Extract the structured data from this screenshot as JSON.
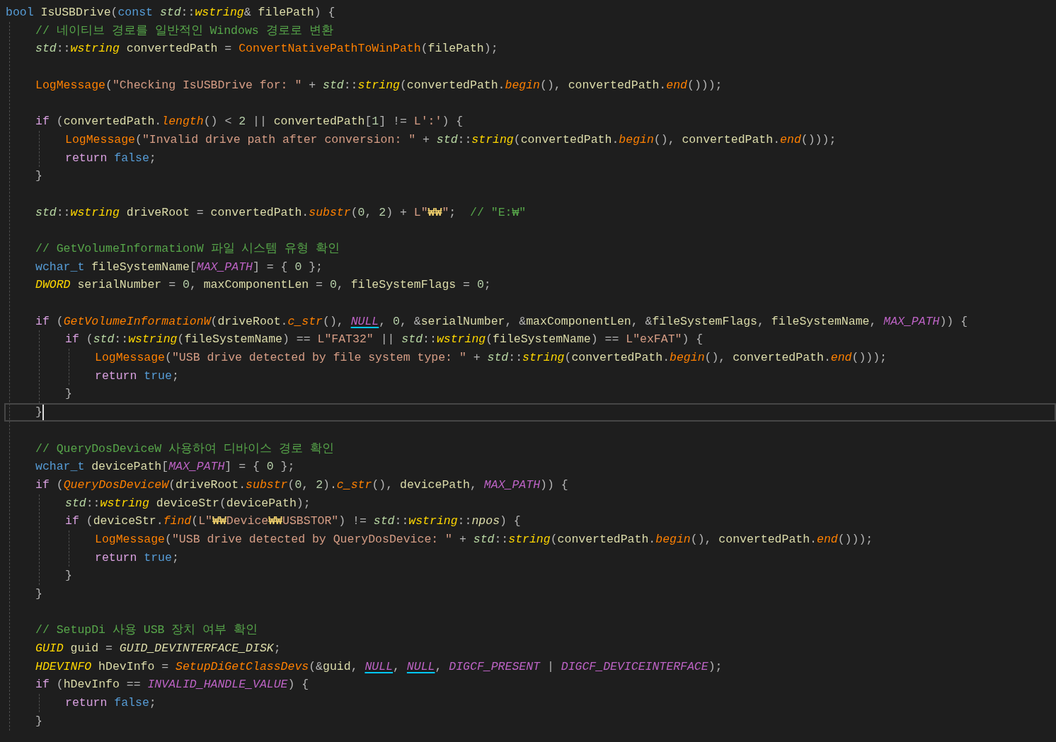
{
  "editor": {
    "lines": [
      {
        "current": false,
        "tokens": [
          {
            "kind": "kw",
            "text": "bool "
          },
          {
            "kind": "var",
            "text": "IsUSBDrive"
          },
          {
            "kind": "p",
            "text": "("
          },
          {
            "kind": "kw",
            "text": "const "
          },
          {
            "kind": "ns",
            "text": "std"
          },
          {
            "kind": "p",
            "text": "::"
          },
          {
            "kind": "type",
            "text": "wstring"
          },
          {
            "kind": "p",
            "text": "& "
          },
          {
            "kind": "var",
            "text": "filePath"
          },
          {
            "kind": "p",
            "text": ") {"
          }
        ],
        "children": [
          {
            "current": false,
            "tokens": [
              {
                "kind": "cmt",
                "text": "// 네이티브 경로를 일반적인 Windows 경로로 변환"
              }
            ]
          },
          {
            "current": false,
            "tokens": [
              {
                "kind": "ns",
                "text": "std"
              },
              {
                "kind": "p",
                "text": "::"
              },
              {
                "kind": "type",
                "text": "wstring"
              },
              {
                "kind": "var",
                "text": " convertedPath"
              },
              {
                "kind": "p",
                "text": " = "
              },
              {
                "kind": "fn",
                "text": "ConvertNativePathToWinPath"
              },
              {
                "kind": "p",
                "text": "("
              },
              {
                "kind": "var",
                "text": "filePath"
              },
              {
                "kind": "p",
                "text": ");"
              }
            ]
          },
          {
            "current": false
          },
          {
            "current": false,
            "tokens": [
              {
                "kind": "fn",
                "text": "LogMessage"
              },
              {
                "kind": "p",
                "text": "("
              },
              {
                "kind": "str",
                "text": "\"Checking IsUSBDrive for: \""
              },
              {
                "kind": "p",
                "text": " + "
              },
              {
                "kind": "ns",
                "text": "std"
              },
              {
                "kind": "p",
                "text": "::"
              },
              {
                "kind": "type",
                "text": "string"
              },
              {
                "kind": "p",
                "text": "("
              },
              {
                "kind": "var",
                "text": "convertedPath"
              },
              {
                "kind": "p",
                "text": "."
              },
              {
                "kind": "method",
                "text": "begin"
              },
              {
                "kind": "p",
                "text": "(), "
              },
              {
                "kind": "var",
                "text": "convertedPath"
              },
              {
                "kind": "p",
                "text": "."
              },
              {
                "kind": "method",
                "text": "end"
              },
              {
                "kind": "p",
                "text": "()));"
              }
            ]
          },
          {
            "current": false
          },
          {
            "current": false,
            "tokens": [
              {
                "kind": "ctrl",
                "text": "if"
              },
              {
                "kind": "p",
                "text": " ("
              },
              {
                "kind": "var",
                "text": "convertedPath"
              },
              {
                "kind": "p",
                "text": "."
              },
              {
                "kind": "method",
                "text": "length"
              },
              {
                "kind": "p",
                "text": "() < "
              },
              {
                "kind": "num",
                "text": "2"
              },
              {
                "kind": "p",
                "text": " || "
              },
              {
                "kind": "var",
                "text": "convertedPath"
              },
              {
                "kind": "p",
                "text": "["
              },
              {
                "kind": "num",
                "text": "1"
              },
              {
                "kind": "p",
                "text": "] != "
              },
              {
                "kind": "str",
                "text": "L':'"
              },
              {
                "kind": "p",
                "text": ") {"
              }
            ],
            "children": [
              {
                "current": false,
                "tokens": [
                  {
                    "kind": "fn",
                    "text": "LogMessage"
                  },
                  {
                    "kind": "p",
                    "text": "("
                  },
                  {
                    "kind": "str",
                    "text": "\"Invalid drive path after conversion: \""
                  },
                  {
                    "kind": "p",
                    "text": " + "
                  },
                  {
                    "kind": "ns",
                    "text": "std"
                  },
                  {
                    "kind": "p",
                    "text": "::"
                  },
                  {
                    "kind": "type",
                    "text": "string"
                  },
                  {
                    "kind": "p",
                    "text": "("
                  },
                  {
                    "kind": "var",
                    "text": "convertedPath"
                  },
                  {
                    "kind": "p",
                    "text": "."
                  },
                  {
                    "kind": "method",
                    "text": "begin"
                  },
                  {
                    "kind": "p",
                    "text": "(), "
                  },
                  {
                    "kind": "var",
                    "text": "convertedPath"
                  },
                  {
                    "kind": "p",
                    "text": "."
                  },
                  {
                    "kind": "method",
                    "text": "end"
                  },
                  {
                    "kind": "p",
                    "text": "()));"
                  }
                ]
              },
              {
                "current": false,
                "tokens": [
                  {
                    "kind": "ctrl",
                    "text": "return "
                  },
                  {
                    "kind": "kw",
                    "text": "false"
                  },
                  {
                    "kind": "p",
                    "text": ";"
                  }
                ]
              }
            ]
          },
          {
            "current": false,
            "tokens": [
              {
                "kind": "p",
                "text": "}"
              }
            ]
          },
          {
            "current": false
          },
          {
            "current": false,
            "tokens": [
              {
                "kind": "ns",
                "text": "std"
              },
              {
                "kind": "p",
                "text": "::"
              },
              {
                "kind": "type",
                "text": "wstring"
              },
              {
                "kind": "var",
                "text": " driveRoot"
              },
              {
                "kind": "p",
                "text": " = "
              },
              {
                "kind": "var",
                "text": "convertedPath"
              },
              {
                "kind": "p",
                "text": "."
              },
              {
                "kind": "method",
                "text": "substr"
              },
              {
                "kind": "p",
                "text": "("
              },
              {
                "kind": "num",
                "text": "0"
              },
              {
                "kind": "p",
                "text": ", "
              },
              {
                "kind": "num",
                "text": "2"
              },
              {
                "kind": "p",
                "text": ") + "
              },
              {
                "kind": "str",
                "text": "L\""
              },
              {
                "kind": "esc",
                "text": "₩₩"
              },
              {
                "kind": "str",
                "text": "\""
              },
              {
                "kind": "p",
                "text": ";  "
              },
              {
                "kind": "cmt",
                "text": "// \"E:₩\""
              }
            ]
          },
          {
            "current": false
          },
          {
            "current": false,
            "tokens": [
              {
                "kind": "cmt",
                "text": "// GetVolumeInformationW 파일 시스템 유형 확인"
              }
            ]
          },
          {
            "current": false,
            "tokens": [
              {
                "kind": "kw",
                "text": "wchar_t"
              },
              {
                "kind": "var",
                "text": " fileSystemName"
              },
              {
                "kind": "p",
                "text": "["
              },
              {
                "kind": "macro",
                "text": "MAX_PATH"
              },
              {
                "kind": "p",
                "text": "] = { "
              },
              {
                "kind": "num",
                "text": "0"
              },
              {
                "kind": "p",
                "text": " };"
              }
            ]
          },
          {
            "current": false,
            "tokens": [
              {
                "kind": "type",
                "text": "DWORD"
              },
              {
                "kind": "var",
                "text": " serialNumber"
              },
              {
                "kind": "p",
                "text": " = "
              },
              {
                "kind": "num",
                "text": "0"
              },
              {
                "kind": "p",
                "text": ", "
              },
              {
                "kind": "var",
                "text": "maxComponentLen"
              },
              {
                "kind": "p",
                "text": " = "
              },
              {
                "kind": "num",
                "text": "0"
              },
              {
                "kind": "p",
                "text": ", "
              },
              {
                "kind": "var",
                "text": "fileSystemFlags"
              },
              {
                "kind": "p",
                "text": " = "
              },
              {
                "kind": "num",
                "text": "0"
              },
              {
                "kind": "p",
                "text": ";"
              }
            ]
          },
          {
            "current": false
          },
          {
            "current": false,
            "tokens": [
              {
                "kind": "ctrl",
                "text": "if"
              },
              {
                "kind": "p",
                "text": " ("
              },
              {
                "kind": "method",
                "text": "GetVolumeInformationW"
              },
              {
                "kind": "p",
                "text": "("
              },
              {
                "kind": "var",
                "text": "driveRoot"
              },
              {
                "kind": "p",
                "text": "."
              },
              {
                "kind": "method",
                "text": "c_str"
              },
              {
                "kind": "p",
                "text": "(), "
              },
              {
                "kind": "null",
                "text": "NULL"
              },
              {
                "kind": "p",
                "text": ", "
              },
              {
                "kind": "num",
                "text": "0"
              },
              {
                "kind": "p",
                "text": ", &"
              },
              {
                "kind": "var",
                "text": "serialNumber"
              },
              {
                "kind": "p",
                "text": ", &"
              },
              {
                "kind": "var",
                "text": "maxComponentLen"
              },
              {
                "kind": "p",
                "text": ", &"
              },
              {
                "kind": "var",
                "text": "fileSystemFlags"
              },
              {
                "kind": "p",
                "text": ", "
              },
              {
                "kind": "var",
                "text": "fileSystemName"
              },
              {
                "kind": "p",
                "text": ", "
              },
              {
                "kind": "macro",
                "text": "MAX_PATH"
              },
              {
                "kind": "p",
                "text": ")) {"
              }
            ],
            "children": [
              {
                "current": false,
                "tokens": [
                  {
                    "kind": "ctrl",
                    "text": "if"
                  },
                  {
                    "kind": "p",
                    "text": " ("
                  },
                  {
                    "kind": "ns",
                    "text": "std"
                  },
                  {
                    "kind": "p",
                    "text": "::"
                  },
                  {
                    "kind": "type",
                    "text": "wstring"
                  },
                  {
                    "kind": "p",
                    "text": "("
                  },
                  {
                    "kind": "var",
                    "text": "fileSystemName"
                  },
                  {
                    "kind": "p",
                    "text": ") == "
                  },
                  {
                    "kind": "str",
                    "text": "L\"FAT32\""
                  },
                  {
                    "kind": "p",
                    "text": " || "
                  },
                  {
                    "kind": "ns",
                    "text": "std"
                  },
                  {
                    "kind": "p",
                    "text": "::"
                  },
                  {
                    "kind": "type",
                    "text": "wstring"
                  },
                  {
                    "kind": "p",
                    "text": "("
                  },
                  {
                    "kind": "var",
                    "text": "fileSystemName"
                  },
                  {
                    "kind": "p",
                    "text": ") == "
                  },
                  {
                    "kind": "str",
                    "text": "L\"exFAT\""
                  },
                  {
                    "kind": "p",
                    "text": ") {"
                  }
                ],
                "children": [
                  {
                    "current": false,
                    "tokens": [
                      {
                        "kind": "fn",
                        "text": "LogMessage"
                      },
                      {
                        "kind": "p",
                        "text": "("
                      },
                      {
                        "kind": "str",
                        "text": "\"USB drive detected by file system type: \""
                      },
                      {
                        "kind": "p",
                        "text": " + "
                      },
                      {
                        "kind": "ns",
                        "text": "std"
                      },
                      {
                        "kind": "p",
                        "text": "::"
                      },
                      {
                        "kind": "type",
                        "text": "string"
                      },
                      {
                        "kind": "p",
                        "text": "("
                      },
                      {
                        "kind": "var",
                        "text": "convertedPath"
                      },
                      {
                        "kind": "p",
                        "text": "."
                      },
                      {
                        "kind": "method",
                        "text": "begin"
                      },
                      {
                        "kind": "p",
                        "text": "(), "
                      },
                      {
                        "kind": "var",
                        "text": "convertedPath"
                      },
                      {
                        "kind": "p",
                        "text": "."
                      },
                      {
                        "kind": "method",
                        "text": "end"
                      },
                      {
                        "kind": "p",
                        "text": "()));"
                      }
                    ]
                  },
                  {
                    "current": false,
                    "tokens": [
                      {
                        "kind": "ctrl",
                        "text": "return "
                      },
                      {
                        "kind": "kw",
                        "text": "true"
                      },
                      {
                        "kind": "p",
                        "text": ";"
                      }
                    ]
                  }
                ]
              },
              {
                "current": false,
                "tokens": [
                  {
                    "kind": "p",
                    "text": "}"
                  }
                ]
              }
            ]
          },
          {
            "current": true,
            "tokens": [
              {
                "kind": "p",
                "text": "}"
              }
            ]
          },
          {
            "current": false
          },
          {
            "current": false,
            "tokens": [
              {
                "kind": "cmt",
                "text": "// QueryDosDeviceW 사용하여 디바이스 경로 확인"
              }
            ]
          },
          {
            "current": false,
            "tokens": [
              {
                "kind": "kw",
                "text": "wchar_t"
              },
              {
                "kind": "var",
                "text": " devicePath"
              },
              {
                "kind": "p",
                "text": "["
              },
              {
                "kind": "macro",
                "text": "MAX_PATH"
              },
              {
                "kind": "p",
                "text": "] = { "
              },
              {
                "kind": "num",
                "text": "0"
              },
              {
                "kind": "p",
                "text": " };"
              }
            ]
          },
          {
            "current": false,
            "tokens": [
              {
                "kind": "ctrl",
                "text": "if"
              },
              {
                "kind": "p",
                "text": " ("
              },
              {
                "kind": "method",
                "text": "QueryDosDeviceW"
              },
              {
                "kind": "p",
                "text": "("
              },
              {
                "kind": "var",
                "text": "driveRoot"
              },
              {
                "kind": "p",
                "text": "."
              },
              {
                "kind": "method",
                "text": "substr"
              },
              {
                "kind": "p",
                "text": "("
              },
              {
                "kind": "num",
                "text": "0"
              },
              {
                "kind": "p",
                "text": ", "
              },
              {
                "kind": "num",
                "text": "2"
              },
              {
                "kind": "p",
                "text": ")."
              },
              {
                "kind": "method",
                "text": "c_str"
              },
              {
                "kind": "p",
                "text": "(), "
              },
              {
                "kind": "var",
                "text": "devicePath"
              },
              {
                "kind": "p",
                "text": ", "
              },
              {
                "kind": "macro",
                "text": "MAX_PATH"
              },
              {
                "kind": "p",
                "text": ")) {"
              }
            ],
            "children": [
              {
                "current": false,
                "tokens": [
                  {
                    "kind": "ns",
                    "text": "std"
                  },
                  {
                    "kind": "p",
                    "text": "::"
                  },
                  {
                    "kind": "type",
                    "text": "wstring"
                  },
                  {
                    "kind": "var",
                    "text": " deviceStr"
                  },
                  {
                    "kind": "p",
                    "text": "("
                  },
                  {
                    "kind": "var",
                    "text": "devicePath"
                  },
                  {
                    "kind": "p",
                    "text": ");"
                  }
                ]
              },
              {
                "current": false,
                "tokens": [
                  {
                    "kind": "ctrl",
                    "text": "if"
                  },
                  {
                    "kind": "p",
                    "text": " ("
                  },
                  {
                    "kind": "var",
                    "text": "deviceStr"
                  },
                  {
                    "kind": "p",
                    "text": "."
                  },
                  {
                    "kind": "method",
                    "text": "find"
                  },
                  {
                    "kind": "p",
                    "text": "("
                  },
                  {
                    "kind": "str",
                    "text": "L\""
                  },
                  {
                    "kind": "esc",
                    "text": "₩₩"
                  },
                  {
                    "kind": "str",
                    "text": "Device"
                  },
                  {
                    "kind": "esc",
                    "text": "₩₩"
                  },
                  {
                    "kind": "str",
                    "text": "USBSTOR\""
                  },
                  {
                    "kind": "p",
                    "text": ") != "
                  },
                  {
                    "kind": "ns",
                    "text": "std"
                  },
                  {
                    "kind": "p",
                    "text": "::"
                  },
                  {
                    "kind": "type",
                    "text": "wstring"
                  },
                  {
                    "kind": "p",
                    "text": "::"
                  },
                  {
                    "kind": "const",
                    "text": "npos"
                  },
                  {
                    "kind": "p",
                    "text": ") {"
                  }
                ],
                "children": [
                  {
                    "current": false,
                    "tokens": [
                      {
                        "kind": "fn",
                        "text": "LogMessage"
                      },
                      {
                        "kind": "p",
                        "text": "("
                      },
                      {
                        "kind": "str",
                        "text": "\"USB drive detected by QueryDosDevice: \""
                      },
                      {
                        "kind": "p",
                        "text": " + "
                      },
                      {
                        "kind": "ns",
                        "text": "std"
                      },
                      {
                        "kind": "p",
                        "text": "::"
                      },
                      {
                        "kind": "type",
                        "text": "string"
                      },
                      {
                        "kind": "p",
                        "text": "("
                      },
                      {
                        "kind": "var",
                        "text": "convertedPath"
                      },
                      {
                        "kind": "p",
                        "text": "."
                      },
                      {
                        "kind": "method",
                        "text": "begin"
                      },
                      {
                        "kind": "p",
                        "text": "(), "
                      },
                      {
                        "kind": "var",
                        "text": "convertedPath"
                      },
                      {
                        "kind": "p",
                        "text": "."
                      },
                      {
                        "kind": "method",
                        "text": "end"
                      },
                      {
                        "kind": "p",
                        "text": "()));"
                      }
                    ]
                  },
                  {
                    "current": false,
                    "tokens": [
                      {
                        "kind": "ctrl",
                        "text": "return "
                      },
                      {
                        "kind": "kw",
                        "text": "true"
                      },
                      {
                        "kind": "p",
                        "text": ";"
                      }
                    ]
                  }
                ]
              },
              {
                "current": false,
                "tokens": [
                  {
                    "kind": "p",
                    "text": "}"
                  }
                ]
              }
            ]
          },
          {
            "current": false,
            "tokens": [
              {
                "kind": "p",
                "text": "}"
              }
            ]
          },
          {
            "current": false
          },
          {
            "current": false,
            "tokens": [
              {
                "kind": "cmt",
                "text": "// SetupDi 사용 USB 장치 여부 확인"
              }
            ]
          },
          {
            "current": false,
            "tokens": [
              {
                "kind": "type",
                "text": "GUID"
              },
              {
                "kind": "var",
                "text": " guid"
              },
              {
                "kind": "p",
                "text": " = "
              },
              {
                "kind": "const",
                "text": "GUID_DEVINTERFACE_DISK"
              },
              {
                "kind": "p",
                "text": ";"
              }
            ]
          },
          {
            "current": false,
            "tokens": [
              {
                "kind": "type",
                "text": "HDEVINFO"
              },
              {
                "kind": "var",
                "text": " hDevInfo"
              },
              {
                "kind": "p",
                "text": " = "
              },
              {
                "kind": "method",
                "text": "SetupDiGetClassDevs"
              },
              {
                "kind": "p",
                "text": "(&"
              },
              {
                "kind": "var",
                "text": "guid"
              },
              {
                "kind": "p",
                "text": ", "
              },
              {
                "kind": "null",
                "text": "NULL"
              },
              {
                "kind": "p",
                "text": ", "
              },
              {
                "kind": "null",
                "text": "NULL"
              },
              {
                "kind": "p",
                "text": ", "
              },
              {
                "kind": "macro",
                "text": "DIGCF_PRESENT"
              },
              {
                "kind": "p",
                "text": " | "
              },
              {
                "kind": "macro",
                "text": "DIGCF_DEVICEINTERFACE"
              },
              {
                "kind": "p",
                "text": ");"
              }
            ]
          },
          {
            "current": false,
            "tokens": [
              {
                "kind": "ctrl",
                "text": "if"
              },
              {
                "kind": "p",
                "text": " ("
              },
              {
                "kind": "var",
                "text": "hDevInfo"
              },
              {
                "kind": "p",
                "text": " == "
              },
              {
                "kind": "macro",
                "text": "INVALID_HANDLE_VALUE"
              },
              {
                "kind": "p",
                "text": ") {"
              }
            ],
            "children": [
              {
                "current": false,
                "tokens": [
                  {
                    "kind": "ctrl",
                    "text": "return "
                  },
                  {
                    "kind": "kw",
                    "text": "false"
                  },
                  {
                    "kind": "p",
                    "text": ";"
                  }
                ]
              }
            ]
          },
          {
            "current": false,
            "tokens": [
              {
                "kind": "p",
                "text": "}"
              }
            ]
          }
        ]
      }
    ]
  }
}
